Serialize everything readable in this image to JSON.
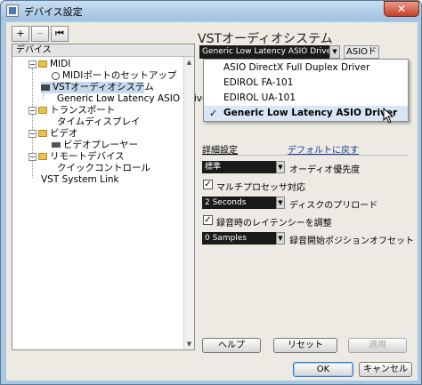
{
  "window": {
    "title": "デバイス設定",
    "close_symbol": "✕"
  },
  "toolbar": {
    "add": "+",
    "remove": "−",
    "reset": "⏮"
  },
  "tree": {
    "header": "デバイス",
    "items": [
      {
        "label": "MIDI",
        "type": "folder",
        "expander": "−"
      },
      {
        "label": "MIDIポートのセットアップ",
        "type": "leaf"
      },
      {
        "label": "VSTオーディオシステム",
        "type": "device"
      },
      {
        "label": "Generic Low Latency ASIO Driver",
        "type": "leaf"
      },
      {
        "label": "トランスポート",
        "type": "folder",
        "expander": "−"
      },
      {
        "label": "タイムディスプレイ",
        "type": "leaf"
      },
      {
        "label": "ビデオ",
        "type": "folder",
        "expander": "−"
      },
      {
        "label": "ビデオプレーヤー",
        "type": "leaf"
      },
      {
        "label": "リモートデバイス",
        "type": "folder",
        "expander": "−"
      },
      {
        "label": "クイックコントロール",
        "type": "leaf"
      },
      {
        "label": "VST System Link",
        "type": "leaf"
      }
    ]
  },
  "panel": {
    "title": "VSTオーディオシステム",
    "driver_value": "Generic Low Latency ASIO Driver",
    "asio_driver_button": "ASIOドライバ",
    "dropdown_options": [
      "ASIO DirectX Full Duplex Driver",
      "EDIROL FA-101",
      "EDIROL UA-101",
      "Generic Low Latency ASIO Driver"
    ],
    "dropdown_selected_check": "✓",
    "advanced_label": "詳細設定",
    "default_link": "デフォルトに戻す",
    "priority_value": "標準",
    "priority_label": "オーディオ優先度",
    "multiprocessor_label": "マルチプロセッサ対応",
    "preload_value": "2 Seconds",
    "preload_label": "ディスクのプリロード",
    "record_latency_label": "録音時のレイテンシーを調整",
    "offset_value": "0 Samples",
    "offset_label": "録音開始ポジションオフセット",
    "check_mark": "✓",
    "arrow": "▼"
  },
  "buttons": {
    "help": "ヘルプ",
    "reset": "リセット",
    "apply": "適用",
    "ok": "OK",
    "cancel": "キャンセル"
  }
}
